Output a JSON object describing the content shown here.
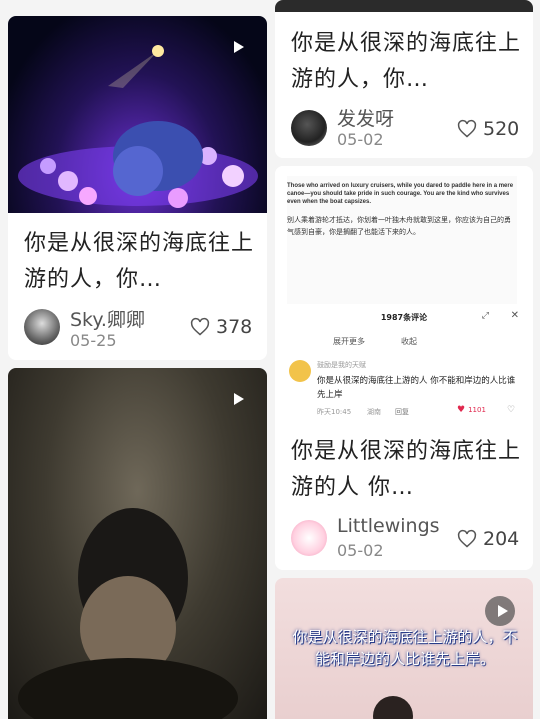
{
  "cards": [
    {
      "title": "你是从很深的海底往上游的人，你…",
      "author": "Sky.卿卿",
      "date": "05-25",
      "likes": "378"
    },
    {
      "title": "你是从很深的海底往上游的人，你…",
      "author": "发发呀",
      "date": "05-02",
      "likes": "520",
      "thumb": {
        "en_text": "Those who arrived on luxury cruisers, while you dared to paddle here in a mere canoe—you should take pride in such courage. You are the kind who survives even when the boat capsizes.",
        "zh_text": "别人乘着游轮才抵达，你划着一叶独木舟就敢到这里，你应该为自己的勇气感到自豪，你是搁翻了也能活下来的人。"
      }
    },
    {
      "title": "你是从很深的海底往上游的人 你…",
      "author": "Littlewings",
      "date": "05-02",
      "likes": "204",
      "thumb": {
        "header": "1987条评论",
        "expand": "展开更多",
        "collapse": "收起",
        "commenter": "鼓励是我的天赋",
        "comment": "你是从很深的海底往上游的人 你不能和岸边的人比谁先上岸",
        "meta_time": "昨天10:45",
        "meta_loc": "湖南",
        "reply": "回复",
        "comment_likes": "1101"
      }
    },
    {
      "caption": "你是从很深的海底往上游的人，不能和岸边的人比谁先上岸。"
    }
  ]
}
